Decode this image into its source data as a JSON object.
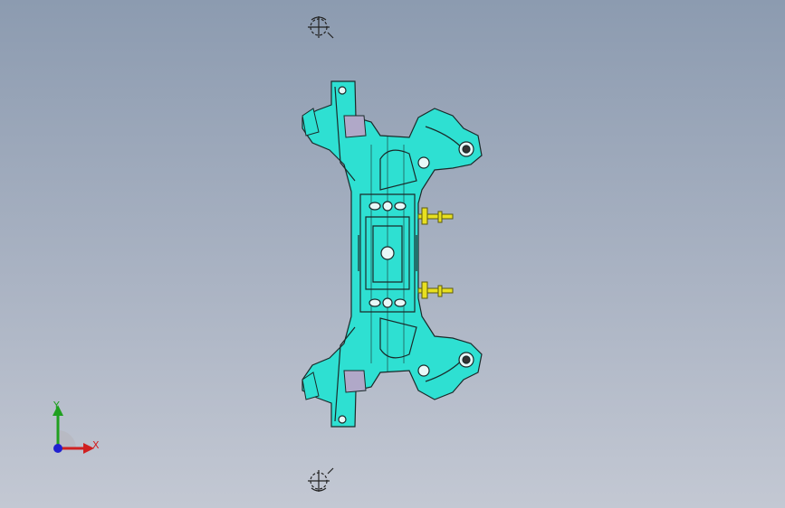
{
  "viewport": {
    "background_top": "#8c9bb0",
    "background_bottom": "#c3c8d3"
  },
  "model": {
    "body_color": "#2ee0d2",
    "edge_color": "#1a2a2a",
    "bolt_color": "#e8e020",
    "mount_color": "#b0a8c8"
  },
  "triad": {
    "x_label": "X",
    "y_label": "Y",
    "x_color": "#d02020",
    "y_color": "#20a020",
    "z_color": "#2020d0"
  }
}
